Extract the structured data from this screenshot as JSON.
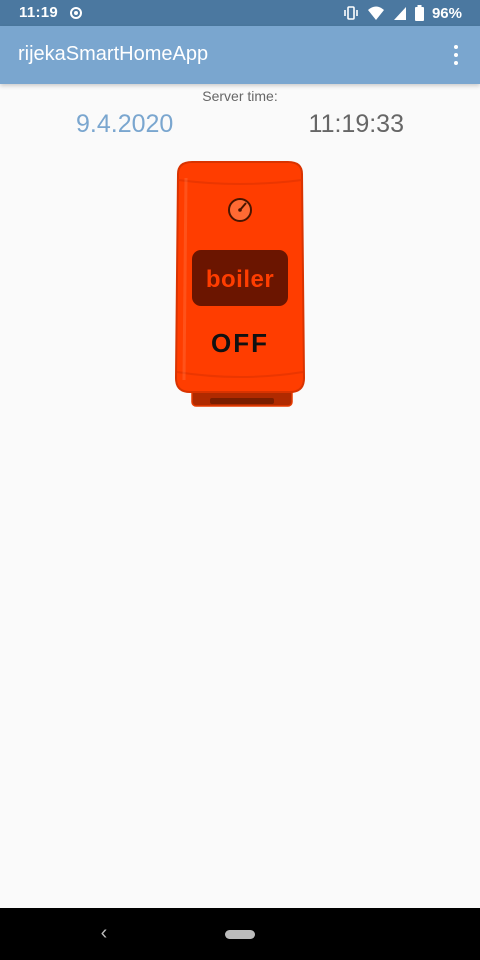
{
  "status_bar": {
    "time": "11:19",
    "battery_percent": "96%",
    "icons": [
      "location-icon",
      "vibrate-icon",
      "wifi-icon",
      "signal-icon",
      "battery-icon"
    ]
  },
  "app_bar": {
    "title": "rijekaSmartHomeApp",
    "menu_icon": "more-vert-icon"
  },
  "server": {
    "label": "Server time:",
    "date": "9.4.2020",
    "time": "11:19:33"
  },
  "boiler": {
    "label": "boiler",
    "state": "OFF",
    "body_color": "#ff3d00",
    "label_bg_color": "#6b1500"
  },
  "nav_bar": {
    "back_glyph": "‹"
  },
  "colors": {
    "status_bar": "#4b78a0",
    "app_bar": "#7aa6cf",
    "date_accent": "#7aa6cf",
    "background": "#fafafa"
  }
}
